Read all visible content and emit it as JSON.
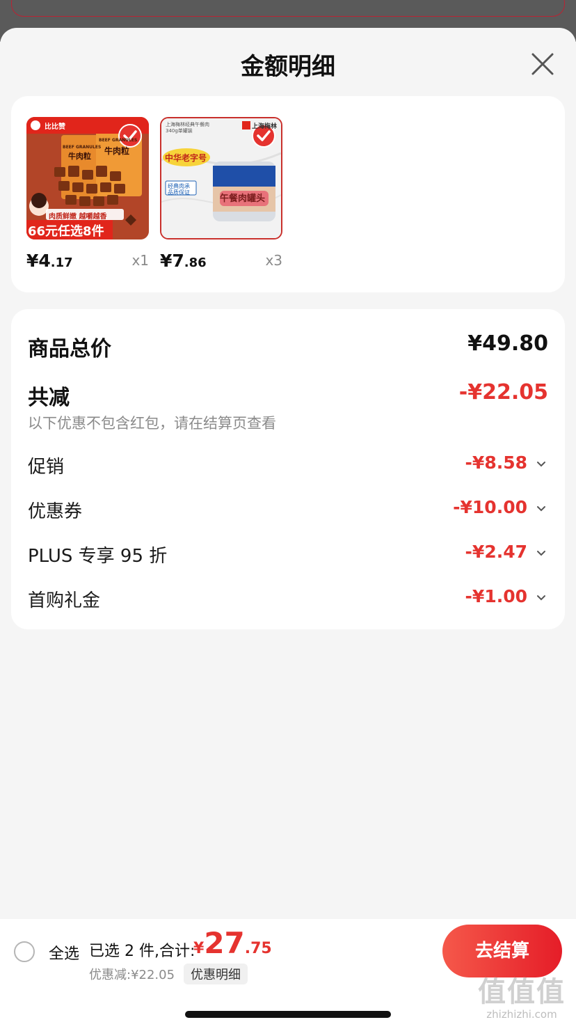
{
  "sheet": {
    "title": "金额明细"
  },
  "products": [
    {
      "price_int": "¥4",
      "price_dec": ".17",
      "qty": "x1",
      "thumb": {
        "brand": "比比赞",
        "label_left": "BEEF GRANULES",
        "label_left_cn": "牛肉粒",
        "label_right": "BEEF GRANULES",
        "label_right_cn": "牛肉粒",
        "slogan": "肉质鲜嫩 越嚼越香",
        "promo": "66元任选8件"
      }
    },
    {
      "price_int": "¥7",
      "price_dec": ".86",
      "qty": "x3",
      "thumb": {
        "top_text": "上海梅林经典午餐肉",
        "top_text2": "340g单罐装",
        "brand": "上海梅林",
        "badge": "中华老字号",
        "sub1": "经典肉承",
        "sub2": "品质保证",
        "can_label": "午餐肉罐头"
      }
    }
  ],
  "summary": {
    "total_label": "商品总价",
    "total_value": "¥49.80",
    "reduce_label": "共减",
    "reduce_value": "-¥22.05",
    "note": "以下优惠不包含红包，请在结算页查看",
    "items": [
      {
        "label": "促销",
        "value": "-¥8.58"
      },
      {
        "label": "优惠券",
        "value": "-¥10.00"
      },
      {
        "label": "PLUS 专享 95 折",
        "value": "-¥2.47"
      },
      {
        "label": "首购礼金",
        "value": "-¥1.00"
      }
    ]
  },
  "bottom": {
    "select_all": "全选",
    "selected_text": "已选 2 件,合计:",
    "total_yen": "¥",
    "total_int": "27",
    "total_dec": ".75",
    "discount": "优惠减:¥22.05",
    "detail": "优惠明细",
    "checkout": "去结算"
  },
  "watermark": {
    "logo": "值值值",
    "site": "zhizhizhi.com"
  },
  "colors": {
    "accent": "#e5332f",
    "sheet_bg": "#f5f5f5",
    "card_bg": "#ffffff"
  }
}
